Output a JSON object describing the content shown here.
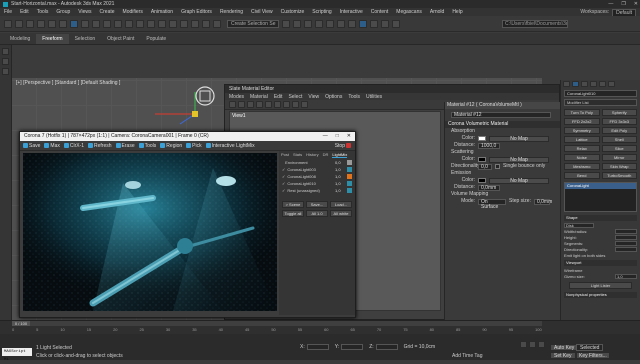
{
  "app": {
    "title": "Start-Horizontal.max - Autodesk 3ds Max 2021",
    "window_buttons": [
      "—",
      "❐",
      "✕"
    ]
  },
  "menubar": {
    "items": [
      "File",
      "Edit",
      "Tools",
      "Group",
      "Views",
      "Create",
      "Modifiers",
      "Animation",
      "Graph Editors",
      "Rendering",
      "Civil View",
      "Customize",
      "Scripting",
      "Interactive",
      "Content",
      "Megascans",
      "Arnold",
      "Help"
    ],
    "workspace_label": "Workspaces:",
    "workspace_value": "Default"
  },
  "toolbar": {
    "selection_set": "Create Selection Se",
    "path": "C:\\Users\\fbiel\\Documents\\3ds Max 2021\\"
  },
  "ribbon": {
    "tabs": [
      "Modeling",
      "Freeform",
      "Selection",
      "Object Paint",
      "Populate"
    ],
    "active": 1
  },
  "viewport": {
    "label": "[+] [Perspective ] [Standard ] [Default Shading ]"
  },
  "sme": {
    "title": "Slate Material Editor",
    "menu": [
      "Modes",
      "Material",
      "Edit",
      "Select",
      "View",
      "Options",
      "Tools",
      "Utilities"
    ],
    "view_label": "View1",
    "window_buttons": [
      "—",
      "❐",
      "✕"
    ]
  },
  "props": {
    "header": "Material #12  ( CoronaVolumeMtl )",
    "name_field": "Material #12",
    "section": "Corona Volumetric Material",
    "absorption": "Absorption",
    "abs_color_label": "Color:",
    "abs_map": "No Map",
    "abs_distance_label": "Distance:",
    "abs_distance": "1000,0",
    "scattering": "Scattering",
    "sca_color_label": "Color:",
    "sca_map": "No Map",
    "directionality_label": "Directionality:",
    "directionality": "0,0",
    "single_bounce": "Single bounce only",
    "emission": "Emission",
    "emi_color_label": "Color:",
    "emi_map": "No Map",
    "emi_distance_label": "Distance:",
    "emi_distance": "0,0mm",
    "volume_mapping": "Volume Mapping",
    "mode_label": "Mode:",
    "mode_value": "On Surface",
    "step_label": "Step size:",
    "step_value": "0,0mm"
  },
  "cmdpanel": {
    "object_name": "CoronaLight010",
    "modifier_list": "Modifier List",
    "buttons": [
      "Turn To Poly",
      "Spherify",
      "FFD 2x2x2",
      "FFD 3x3x3",
      "Symmetry",
      "Edit Poly",
      "Lattice",
      "Shell",
      "Relax",
      "Slice",
      "Noise",
      "Mirror",
      "Meshsmo",
      "Skin Wrap",
      "Bend",
      "TurboSmooth"
    ],
    "stack_item": "CoronaLight",
    "shape_section": "Shape",
    "shape_value": "Disk",
    "width_label": "Width/radius:",
    "height_label": "Height:",
    "segments_label": "Segments:",
    "directionality_label": "Directionality:",
    "emit_both": "Emit light on both sides",
    "viewport_section": "Viewport",
    "wireframe": "Wireframe",
    "gizmo_label": "Gizmo size:",
    "gizmo_value": "1,0",
    "lister_button": "Light Lister",
    "nonphysical": "Nonphysical properties"
  },
  "vfb": {
    "title": "Corona 7 (Hotfix 1) | 787×472px (1:1) | Camera: CoronaCamera001 | Frame 0 (CR)",
    "window_buttons": [
      "—",
      "□",
      "✕"
    ],
    "tools": [
      "Save",
      "Max",
      "ClrX-1",
      "Refresh",
      "Erase",
      "Tools",
      "Region",
      "Pick",
      "Interactive LightMix"
    ],
    "stop": "Stop",
    "side_tabs": [
      "Post",
      "Stats",
      "History",
      "DR",
      "LightMix"
    ],
    "active_tab": 4,
    "lights": [
      {
        "name": "Environment",
        "value": "0,0",
        "checked": false,
        "color": "#9a9a9a"
      },
      {
        "name": "CoronaLight003",
        "value": "1,0",
        "checked": true,
        "color": "#2e8fa8"
      },
      {
        "name": "CoronaLight008",
        "value": "1,0",
        "checked": true,
        "color": "#e2731d"
      },
      {
        "name": "CoronaLight010",
        "value": "1,0",
        "checked": true,
        "color": "#2e8fa8"
      },
      {
        "name": "Rest (unassigned)",
        "value": "1,0",
        "checked": true,
        "color": "#2e8fa8"
      }
    ],
    "buttons": [
      "> Scene",
      "Save...",
      "Load...",
      "Toggle all",
      "All 1.0",
      "All white"
    ]
  },
  "timeline": {
    "frame_display": "0 / 100",
    "ticks": [
      "0",
      "5",
      "10",
      "15",
      "20",
      "25",
      "30",
      "35",
      "40",
      "45",
      "50",
      "55",
      "60",
      "65",
      "70",
      "75",
      "80",
      "85",
      "90",
      "95",
      "100"
    ]
  },
  "status": {
    "maxscript": "MAXScript Mi",
    "line1": "1 Light Selected",
    "line2": "Click or click-and-drag to select objects",
    "x_label": "X:",
    "y_label": "Y:",
    "z_label": "Z:",
    "grid_label": "Grid = 10,0cm",
    "add_time_tag": "Add Time Tag",
    "auto_key": "Auto Key",
    "set_key": "Set Key",
    "selected": "Selected",
    "key_filters": "Key Filters..."
  },
  "colors": {
    "accent": "#3aa0d6",
    "render_cyan": "#1ea7c4"
  }
}
